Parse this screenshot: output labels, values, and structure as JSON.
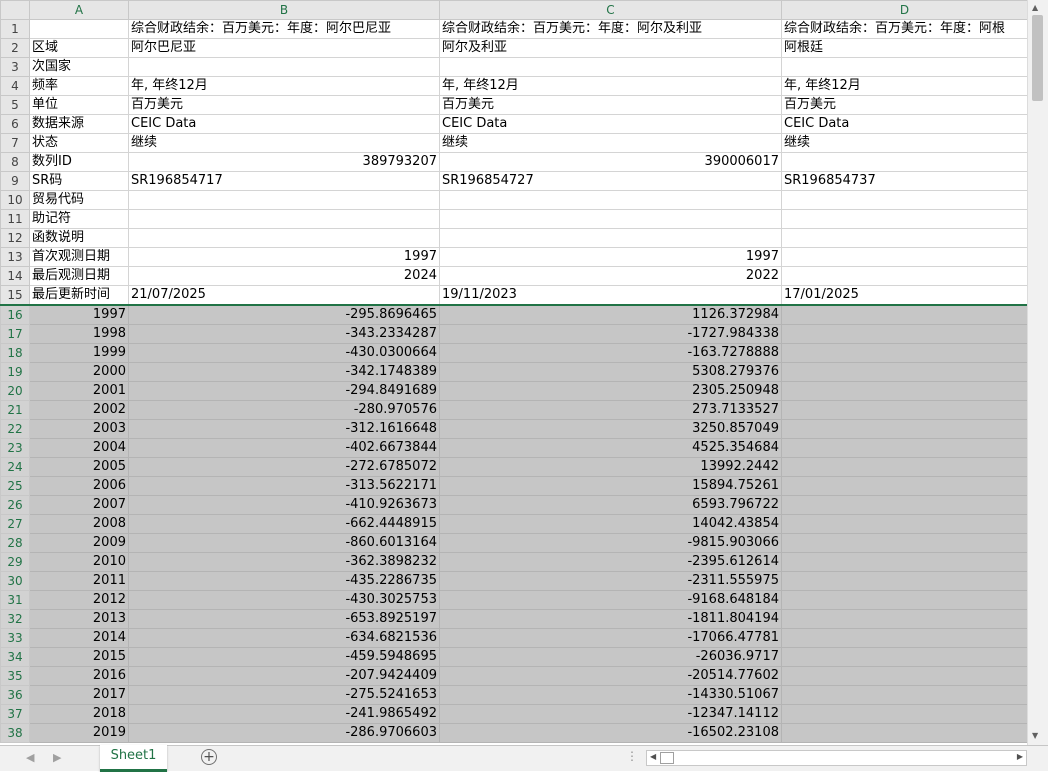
{
  "columns": [
    "A",
    "B",
    "C",
    "D"
  ],
  "sheet_tab": "Sheet1",
  "add_sheet_symbol": "+",
  "header_rows": [
    {
      "n": "1",
      "a": "",
      "b": "综合财政结余：百万美元：年度：阿尔巴尼亚",
      "c": "综合财政结余：百万美元：年度：阿尔及利亚",
      "d": "综合财政结余：百万美元：年度：阿根"
    },
    {
      "n": "2",
      "a": "区域",
      "b": "阿尔巴尼亚",
      "c": "阿尔及利亚",
      "d": "阿根廷"
    },
    {
      "n": "3",
      "a": "次国家",
      "b": "",
      "c": "",
      "d": ""
    },
    {
      "n": "4",
      "a": "频率",
      "b": "年, 年终12月",
      "c": "年, 年终12月",
      "d": "年, 年终12月"
    },
    {
      "n": "5",
      "a": "单位",
      "b": "百万美元",
      "c": "百万美元",
      "d": "百万美元"
    },
    {
      "n": "6",
      "a": "数据来源",
      "b": "CEIC Data",
      "c": "CEIC Data",
      "d": "CEIC Data"
    },
    {
      "n": "7",
      "a": "状态",
      "b": "继续",
      "c": "继续",
      "d": "继续"
    },
    {
      "n": "8",
      "a": "数列ID",
      "b": "389793207",
      "c": "390006017",
      "d": ""
    },
    {
      "n": "9",
      "a": "SR码",
      "b": "SR196854717",
      "c": "SR196854727",
      "d": "SR196854737"
    },
    {
      "n": "10",
      "a": "贸易代码",
      "b": "",
      "c": "",
      "d": ""
    },
    {
      "n": "11",
      "a": "助记符",
      "b": "",
      "c": "",
      "d": ""
    },
    {
      "n": "12",
      "a": "函数说明",
      "b": "",
      "c": "",
      "d": ""
    },
    {
      "n": "13",
      "a": "首次观测日期",
      "b": "1997",
      "c": "1997",
      "d": ""
    },
    {
      "n": "14",
      "a": "最后观测日期",
      "b": "2024",
      "c": "2022",
      "d": ""
    },
    {
      "n": "15",
      "a": "最后更新时间",
      "b": "21/07/2025",
      "c": "19/11/2023",
      "d": "17/01/2025"
    }
  ],
  "data_rows": [
    {
      "n": "16",
      "a": "1997",
      "b": "-295.8696465",
      "c": "1126.372984",
      "d": ""
    },
    {
      "n": "17",
      "a": "1998",
      "b": "-343.2334287",
      "c": "-1727.984338",
      "d": ""
    },
    {
      "n": "18",
      "a": "1999",
      "b": "-430.0300664",
      "c": "-163.7278888",
      "d": ""
    },
    {
      "n": "19",
      "a": "2000",
      "b": "-342.1748389",
      "c": "5308.279376",
      "d": ""
    },
    {
      "n": "20",
      "a": "2001",
      "b": "-294.8491689",
      "c": "2305.250948",
      "d": ""
    },
    {
      "n": "21",
      "a": "2002",
      "b": "-280.970576",
      "c": "273.7133527",
      "d": ""
    },
    {
      "n": "22",
      "a": "2003",
      "b": "-312.1616648",
      "c": "3250.857049",
      "d": ""
    },
    {
      "n": "23",
      "a": "2004",
      "b": "-402.6673844",
      "c": "4525.354684",
      "d": ""
    },
    {
      "n": "24",
      "a": "2005",
      "b": "-272.6785072",
      "c": "13992.2442",
      "d": ""
    },
    {
      "n": "25",
      "a": "2006",
      "b": "-313.5622171",
      "c": "15894.75261",
      "d": ""
    },
    {
      "n": "26",
      "a": "2007",
      "b": "-410.9263673",
      "c": "6593.796722",
      "d": ""
    },
    {
      "n": "27",
      "a": "2008",
      "b": "-662.4448915",
      "c": "14042.43854",
      "d": ""
    },
    {
      "n": "28",
      "a": "2009",
      "b": "-860.6013164",
      "c": "-9815.903066",
      "d": ""
    },
    {
      "n": "29",
      "a": "2010",
      "b": "-362.3898232",
      "c": "-2395.612614",
      "d": ""
    },
    {
      "n": "30",
      "a": "2011",
      "b": "-435.2286735",
      "c": "-2311.555975",
      "d": ""
    },
    {
      "n": "31",
      "a": "2012",
      "b": "-430.3025753",
      "c": "-9168.648184",
      "d": ""
    },
    {
      "n": "32",
      "a": "2013",
      "b": "-653.8925197",
      "c": "-1811.804194",
      "d": ""
    },
    {
      "n": "33",
      "a": "2014",
      "b": "-634.6821536",
      "c": "-17066.47781",
      "d": ""
    },
    {
      "n": "34",
      "a": "2015",
      "b": "-459.5948695",
      "c": "-26036.9717",
      "d": ""
    },
    {
      "n": "35",
      "a": "2016",
      "b": "-207.9424409",
      "c": "-20514.77602",
      "d": ""
    },
    {
      "n": "36",
      "a": "2017",
      "b": "-275.5241653",
      "c": "-14330.51067",
      "d": ""
    },
    {
      "n": "37",
      "a": "2018",
      "b": "-241.9865492",
      "c": "-12347.14112",
      "d": ""
    },
    {
      "n": "38",
      "a": "2019",
      "b": "-286.9706603",
      "c": "-16502.23108",
      "d": ""
    }
  ]
}
